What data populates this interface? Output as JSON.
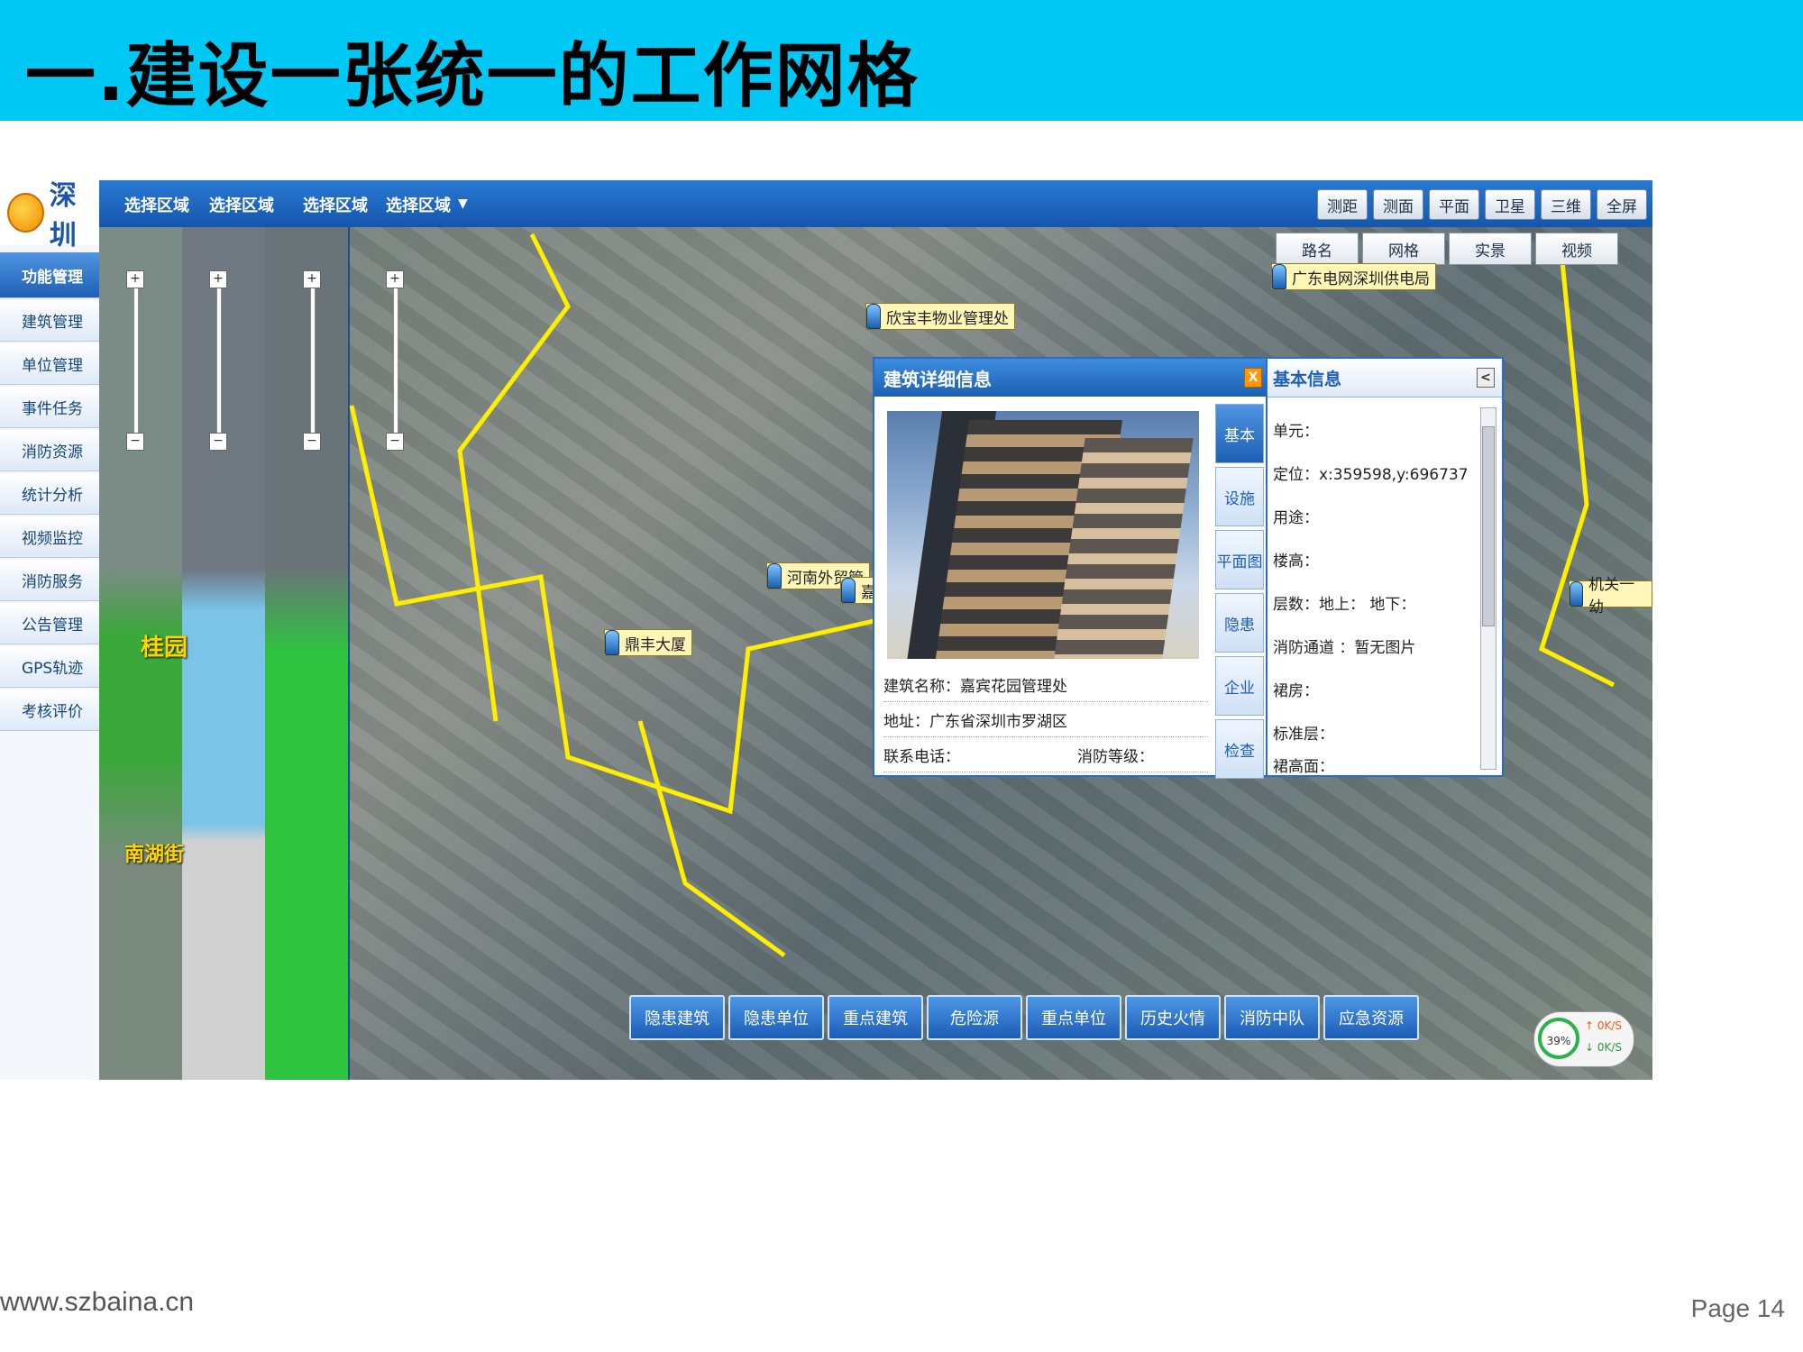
{
  "slide": {
    "title": "一.建设一张统一的工作网格",
    "footer_url": "www.szbaina.cn",
    "page": "Page 14",
    "header_color": "#00c8f5"
  },
  "app": {
    "logo_text": "深圳",
    "nav": [
      {
        "label": "功能管理",
        "active": true
      },
      {
        "label": "建筑管理"
      },
      {
        "label": "单位管理"
      },
      {
        "label": "事件任务"
      },
      {
        "label": "消防资源"
      },
      {
        "label": "统计分析"
      },
      {
        "label": "视频监控"
      },
      {
        "label": "消防服务"
      },
      {
        "label": "公告管理"
      },
      {
        "label": "GPS轨迹"
      },
      {
        "label": "考核评价"
      }
    ],
    "region_selectors": [
      "选择区域",
      "选择区域",
      "选择区域",
      "选择区域"
    ],
    "district_labels": [
      "桂园",
      "南湖街"
    ],
    "view_buttons": [
      "测距",
      "测面",
      "平面",
      "卫星",
      "三维",
      "全屏"
    ],
    "layer_buttons": [
      "路名",
      "网格",
      "实景",
      "视频"
    ],
    "markers": [
      "欣宝丰物业管理处",
      "广东电网深圳供电局",
      "河南外贸管",
      "嘉",
      "鼎丰大厦",
      "机关一幼"
    ],
    "detail": {
      "title": "建筑详细信息",
      "close": "X",
      "tabs": [
        "基本",
        "设施",
        "平面图",
        "隐患",
        "企业",
        "检查"
      ],
      "name_label": "建筑名称：嘉宾花园管理处",
      "address_label": "地址：广东省深圳市罗湖区",
      "phone_label": "联系电话：",
      "fire_level_label": "消防等级："
    },
    "basic_info": {
      "title": "基本信息",
      "collapse": "<",
      "items": [
        "单元：",
        "定位：x:359598,y:696737",
        "用途：",
        "楼高：",
        "层数：地上：  地下：",
        "消防通道  ：暂无图片",
        "裙房：",
        "标准层：",
        "裙高面："
      ]
    },
    "bottom_buttons": [
      "隐患建筑",
      "隐患单位",
      "重点建筑",
      "危险源",
      "重点单位",
      "历史火情",
      "消防中队",
      "应急资源"
    ],
    "net_speed": {
      "percent": "39%",
      "up": "0K/S",
      "down": "0K/S"
    }
  }
}
